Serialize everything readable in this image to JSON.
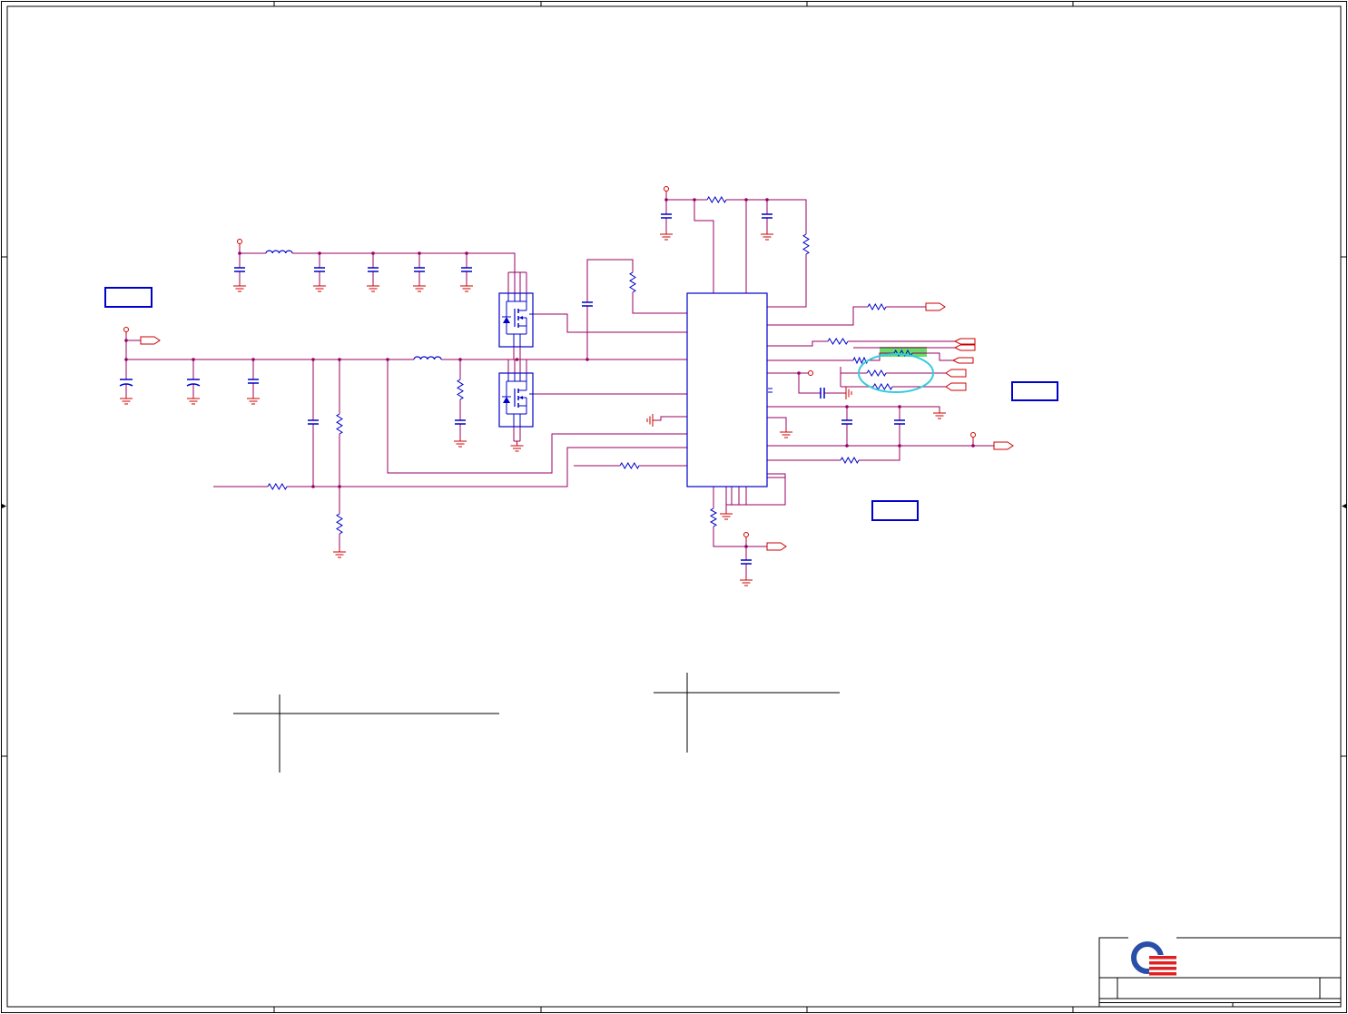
{
  "colors": {
    "border": "#000000",
    "wire": "#990066",
    "part": "#0000CC",
    "power": "#CC0000",
    "junction": "#990066",
    "highlight_fill": "#66DD66",
    "highlight_ring": "#33CCDD",
    "logo_blue": "#2A4FA8",
    "logo_red": "#E02020"
  },
  "logo": "company-logo-icon"
}
